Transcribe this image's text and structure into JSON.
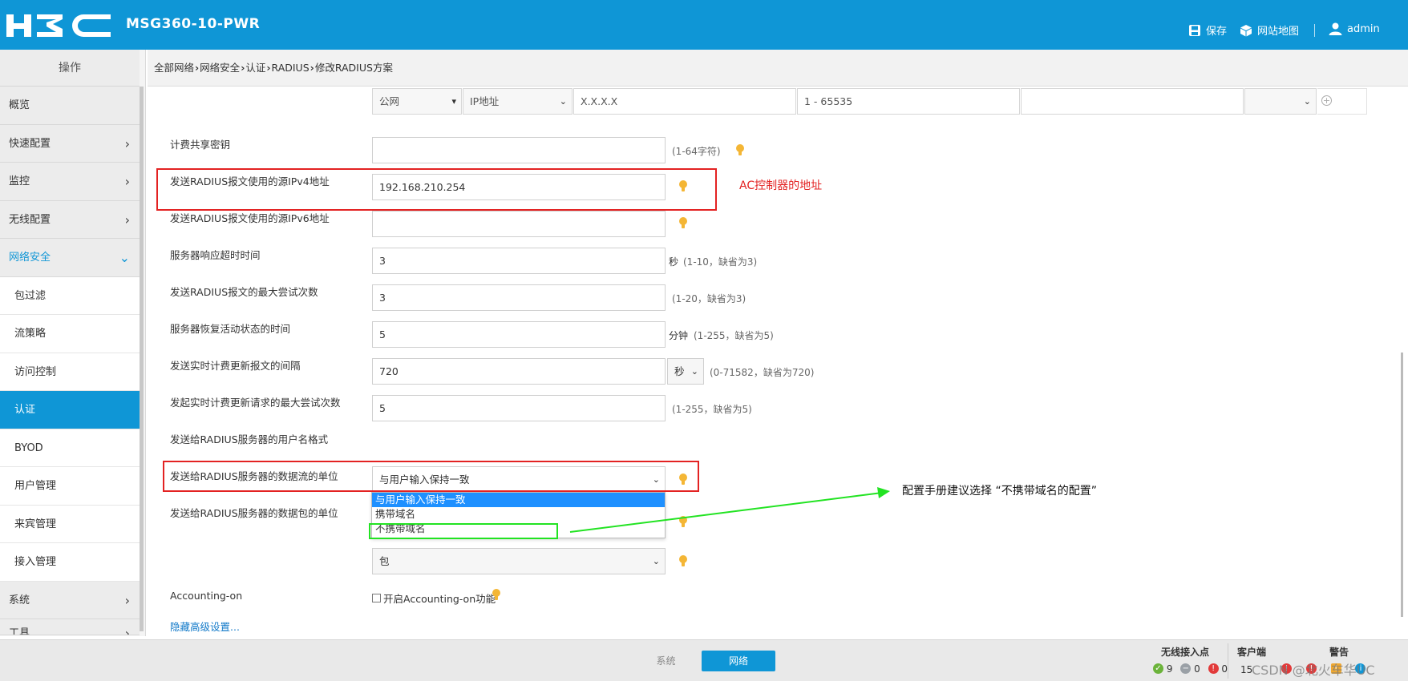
{
  "header": {
    "model": "MSG360-10-PWR",
    "save_label": "保存",
    "sitemap_label": "网站地图",
    "user_label": "admin"
  },
  "sidebar": {
    "title": "操作",
    "items": [
      {
        "label": "概览"
      },
      {
        "label": "快速配置"
      },
      {
        "label": "监控"
      },
      {
        "label": "无线配置"
      },
      {
        "label": "网络安全"
      },
      {
        "label": "包过滤"
      },
      {
        "label": "流策略"
      },
      {
        "label": "访问控制"
      },
      {
        "label": "认证"
      },
      {
        "label": "BYOD"
      },
      {
        "label": "用户管理"
      },
      {
        "label": "来宾管理"
      },
      {
        "label": "接入管理"
      },
      {
        "label": "系统"
      },
      {
        "label": "工具"
      }
    ]
  },
  "breadcrumb": [
    "全部网络",
    "网络安全",
    "认证",
    "RADIUS",
    "修改RADIUS方案"
  ],
  "top_row": {
    "vpn": "公网",
    "addr_type": "IP地址",
    "addr_placeholder": "X.X.X.X",
    "port_placeholder": "1 - 65535"
  },
  "form": {
    "acct_key": {
      "label": "计费共享密钥",
      "value": "",
      "hint": "(1-64字符)"
    },
    "src_ipv4": {
      "label": "发送RADIUS报文使用的源IPv4地址",
      "value": "192.168.210.254"
    },
    "src_ipv6": {
      "label": "发送RADIUS报文使用的源IPv6地址",
      "value": ""
    },
    "timeout": {
      "label": "服务器响应超时时间",
      "value": "3",
      "unit": "秒",
      "hint": "(1-10，缺省为3)"
    },
    "retries": {
      "label": "发送RADIUS报文的最大尝试次数",
      "value": "3",
      "hint": "(1-20，缺省为3)"
    },
    "quiet": {
      "label": "服务器恢复活动状态的时间",
      "value": "5",
      "unit": "分钟",
      "hint": "(1-255，缺省为5)"
    },
    "realtime_interval": {
      "label": "发送实时计费更新报文的间隔",
      "value": "720",
      "unit_select": "秒",
      "hint": "(0-71582，缺省为720)"
    },
    "realtime_retries": {
      "label": "发起实时计费更新请求的最大尝试次数",
      "value": "5",
      "hint": "(1-255，缺省为5)"
    },
    "username_format": {
      "label": "发送给RADIUS服务器的用户名格式",
      "value": "与用户输入保持一致",
      "options": [
        "与用户输入保持一致",
        "携带域名",
        "不携带域名"
      ]
    },
    "data_flow_unit": {
      "label": "发送给RADIUS服务器的数据流的单位"
    },
    "packet_unit": {
      "label": "发送给RADIUS服务器的数据包的单位",
      "value": "包"
    },
    "accounting_on": {
      "label": "Accounting-on",
      "checkbox_label": "开启Accounting-on功能",
      "checked": false
    },
    "hide_advanced": "隐藏高级设置..."
  },
  "annotations": {
    "ac_note": "AC控制器的地址",
    "manual_note": "配置手册建议选择 “不携带域名的配置”"
  },
  "footer": {
    "tabs": [
      "系统",
      "网络"
    ],
    "active_tab": "网络",
    "wireless_ap_title": "无线接入点",
    "ap_online": "9",
    "ap_offline": "0",
    "ap_alarm": "0",
    "clients_title": "客户端",
    "clients_count": "15",
    "alerts_title": "警告",
    "watermark": "CSDN @北火车华UC"
  },
  "colors": {
    "header_blue": "#0f96d6",
    "annotation_red": "#e32222",
    "annotation_green": "#22e322"
  }
}
